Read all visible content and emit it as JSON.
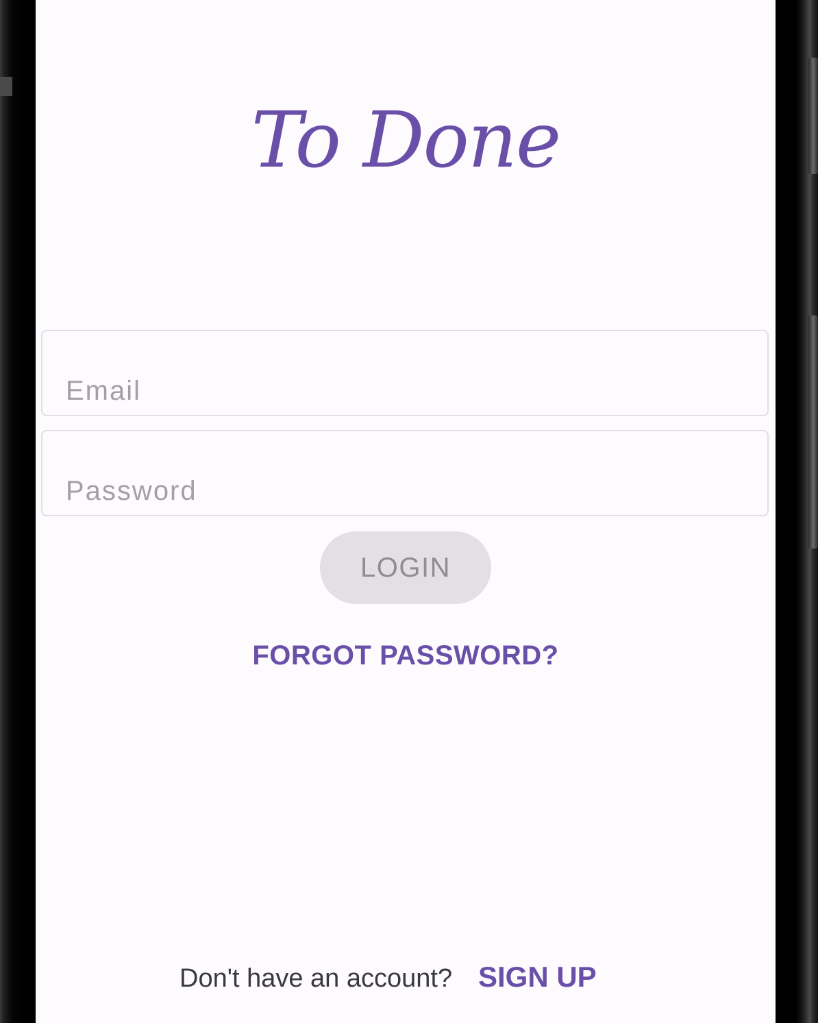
{
  "app": {
    "logo_text": "To Done"
  },
  "form": {
    "email_placeholder": "Email",
    "email_value": "",
    "password_placeholder": "Password",
    "password_value": "",
    "login_label": "LOGIN",
    "forgot_label": "FORGOT PASSWORD?"
  },
  "footer": {
    "prompt": "Don't have an account?",
    "signup_label": "SIGN UP"
  },
  "colors": {
    "accent": "#6a4fa8",
    "background": "#fefbfe",
    "button_disabled_bg": "#e3e0e4",
    "button_disabled_text": "#8f8c92"
  }
}
